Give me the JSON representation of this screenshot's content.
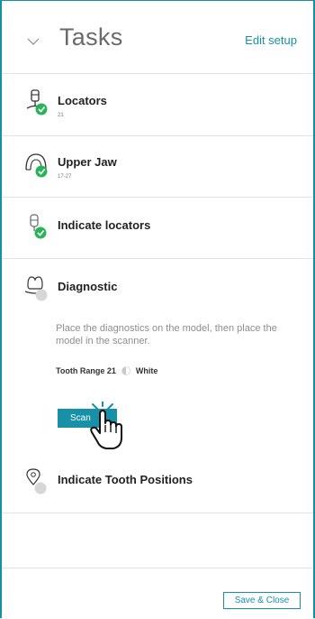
{
  "header": {
    "title": "Tasks",
    "edit_label": "Edit setup",
    "toggle_icon": "chevron-down-icon"
  },
  "tasks": [
    {
      "name": "Locators",
      "sub": "21",
      "icon": "locator-icon",
      "status": "completed"
    },
    {
      "name": "Upper Jaw",
      "sub": "17-27",
      "icon": "upper-jaw-icon",
      "status": "completed"
    },
    {
      "name": "Indicate locators",
      "sub": "",
      "icon": "locator-indicate-icon",
      "status": "completed"
    },
    {
      "name": "Diagnostic",
      "sub": "",
      "icon": "diagnostic-icon",
      "status": "pending",
      "description": "Place the diagnostics on the model, then place the model in the scanner.",
      "tooth_range_label": "Tooth Range 21",
      "shade": "White",
      "scan_label": "Scan"
    },
    {
      "name": "Indicate Tooth Positions",
      "sub": "",
      "icon": "location-pin-icon",
      "status": "pending"
    }
  ],
  "footer": {
    "save_label": "Save & Close"
  },
  "colors": {
    "accent": "#1591a6",
    "done": "#2bb35a",
    "pending": "#d7d7d7"
  }
}
